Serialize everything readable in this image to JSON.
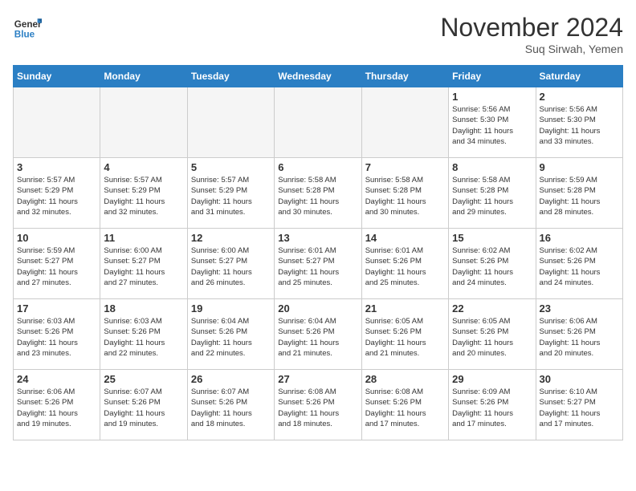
{
  "header": {
    "logo_line1": "General",
    "logo_line2": "Blue",
    "month": "November 2024",
    "location": "Suq Sirwah, Yemen"
  },
  "weekdays": [
    "Sunday",
    "Monday",
    "Tuesday",
    "Wednesday",
    "Thursday",
    "Friday",
    "Saturday"
  ],
  "weeks": [
    [
      {
        "day": "",
        "empty": true
      },
      {
        "day": "",
        "empty": true
      },
      {
        "day": "",
        "empty": true
      },
      {
        "day": "",
        "empty": true
      },
      {
        "day": "",
        "empty": true
      },
      {
        "day": "1",
        "info": "Sunrise: 5:56 AM\nSunset: 5:30 PM\nDaylight: 11 hours\nand 34 minutes."
      },
      {
        "day": "2",
        "info": "Sunrise: 5:56 AM\nSunset: 5:30 PM\nDaylight: 11 hours\nand 33 minutes."
      }
    ],
    [
      {
        "day": "3",
        "info": "Sunrise: 5:57 AM\nSunset: 5:29 PM\nDaylight: 11 hours\nand 32 minutes."
      },
      {
        "day": "4",
        "info": "Sunrise: 5:57 AM\nSunset: 5:29 PM\nDaylight: 11 hours\nand 32 minutes."
      },
      {
        "day": "5",
        "info": "Sunrise: 5:57 AM\nSunset: 5:29 PM\nDaylight: 11 hours\nand 31 minutes."
      },
      {
        "day": "6",
        "info": "Sunrise: 5:58 AM\nSunset: 5:28 PM\nDaylight: 11 hours\nand 30 minutes."
      },
      {
        "day": "7",
        "info": "Sunrise: 5:58 AM\nSunset: 5:28 PM\nDaylight: 11 hours\nand 30 minutes."
      },
      {
        "day": "8",
        "info": "Sunrise: 5:58 AM\nSunset: 5:28 PM\nDaylight: 11 hours\nand 29 minutes."
      },
      {
        "day": "9",
        "info": "Sunrise: 5:59 AM\nSunset: 5:28 PM\nDaylight: 11 hours\nand 28 minutes."
      }
    ],
    [
      {
        "day": "10",
        "info": "Sunrise: 5:59 AM\nSunset: 5:27 PM\nDaylight: 11 hours\nand 27 minutes."
      },
      {
        "day": "11",
        "info": "Sunrise: 6:00 AM\nSunset: 5:27 PM\nDaylight: 11 hours\nand 27 minutes."
      },
      {
        "day": "12",
        "info": "Sunrise: 6:00 AM\nSunset: 5:27 PM\nDaylight: 11 hours\nand 26 minutes."
      },
      {
        "day": "13",
        "info": "Sunrise: 6:01 AM\nSunset: 5:27 PM\nDaylight: 11 hours\nand 25 minutes."
      },
      {
        "day": "14",
        "info": "Sunrise: 6:01 AM\nSunset: 5:26 PM\nDaylight: 11 hours\nand 25 minutes."
      },
      {
        "day": "15",
        "info": "Sunrise: 6:02 AM\nSunset: 5:26 PM\nDaylight: 11 hours\nand 24 minutes."
      },
      {
        "day": "16",
        "info": "Sunrise: 6:02 AM\nSunset: 5:26 PM\nDaylight: 11 hours\nand 24 minutes."
      }
    ],
    [
      {
        "day": "17",
        "info": "Sunrise: 6:03 AM\nSunset: 5:26 PM\nDaylight: 11 hours\nand 23 minutes."
      },
      {
        "day": "18",
        "info": "Sunrise: 6:03 AM\nSunset: 5:26 PM\nDaylight: 11 hours\nand 22 minutes."
      },
      {
        "day": "19",
        "info": "Sunrise: 6:04 AM\nSunset: 5:26 PM\nDaylight: 11 hours\nand 22 minutes."
      },
      {
        "day": "20",
        "info": "Sunrise: 6:04 AM\nSunset: 5:26 PM\nDaylight: 11 hours\nand 21 minutes."
      },
      {
        "day": "21",
        "info": "Sunrise: 6:05 AM\nSunset: 5:26 PM\nDaylight: 11 hours\nand 21 minutes."
      },
      {
        "day": "22",
        "info": "Sunrise: 6:05 AM\nSunset: 5:26 PM\nDaylight: 11 hours\nand 20 minutes."
      },
      {
        "day": "23",
        "info": "Sunrise: 6:06 AM\nSunset: 5:26 PM\nDaylight: 11 hours\nand 20 minutes."
      }
    ],
    [
      {
        "day": "24",
        "info": "Sunrise: 6:06 AM\nSunset: 5:26 PM\nDaylight: 11 hours\nand 19 minutes."
      },
      {
        "day": "25",
        "info": "Sunrise: 6:07 AM\nSunset: 5:26 PM\nDaylight: 11 hours\nand 19 minutes."
      },
      {
        "day": "26",
        "info": "Sunrise: 6:07 AM\nSunset: 5:26 PM\nDaylight: 11 hours\nand 18 minutes."
      },
      {
        "day": "27",
        "info": "Sunrise: 6:08 AM\nSunset: 5:26 PM\nDaylight: 11 hours\nand 18 minutes."
      },
      {
        "day": "28",
        "info": "Sunrise: 6:08 AM\nSunset: 5:26 PM\nDaylight: 11 hours\nand 17 minutes."
      },
      {
        "day": "29",
        "info": "Sunrise: 6:09 AM\nSunset: 5:26 PM\nDaylight: 11 hours\nand 17 minutes."
      },
      {
        "day": "30",
        "info": "Sunrise: 6:10 AM\nSunset: 5:27 PM\nDaylight: 11 hours\nand 17 minutes."
      }
    ]
  ]
}
